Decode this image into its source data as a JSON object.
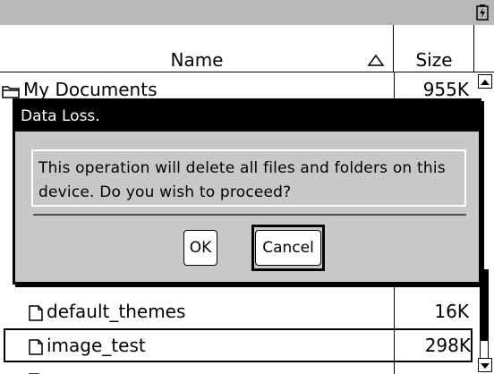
{
  "statusbar": {
    "battery_icon": "battery-charging-icon"
  },
  "columns": {
    "name_label": "Name",
    "size_label": "Size",
    "sort_icon": "sort-ascending-triangle-icon"
  },
  "rows": [
    {
      "name": "My Documents",
      "size": "955K",
      "icon": "folder-icon"
    },
    {
      "name": "default_themes",
      "size": "16K",
      "icon": "document-icon"
    },
    {
      "name": "image_test",
      "size": "298K",
      "icon": "document-icon",
      "selected": true
    }
  ],
  "dialog": {
    "title": "Data Loss.",
    "message": "This operation will delete all files and folders on this device. Do you wish to proceed?",
    "ok_label": "OK",
    "cancel_label": "Cancel",
    "focused_button": "Cancel"
  },
  "colors": {
    "statusbar_bg": "#b8b8b8",
    "dialog_bg": "#c8c8c8",
    "title_bg": "#000000",
    "title_fg": "#ffffff"
  }
}
